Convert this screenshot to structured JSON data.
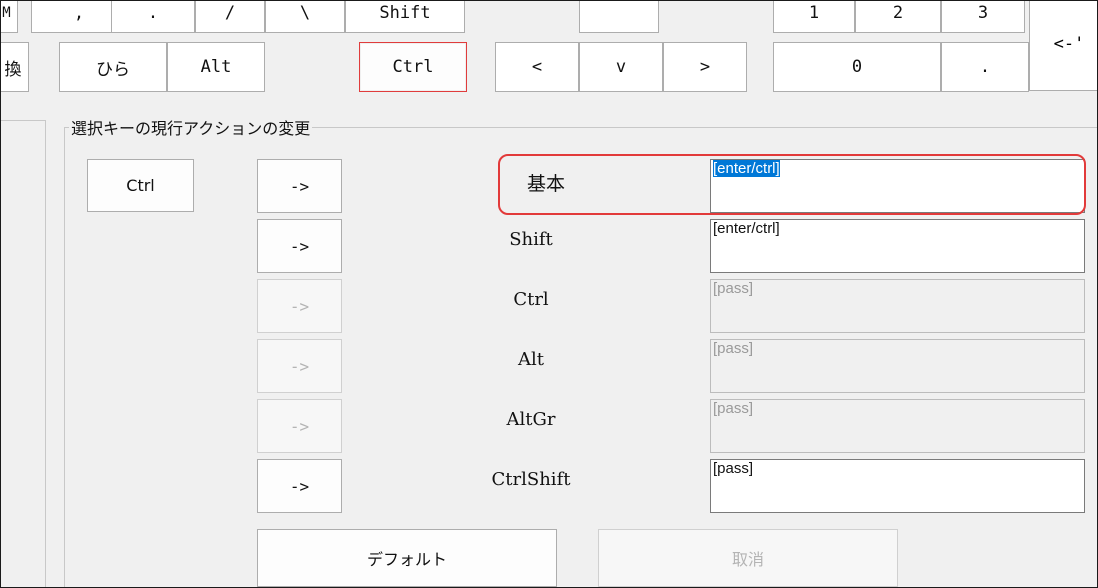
{
  "keyboard": {
    "row1": {
      "m": "M",
      "comma": ",",
      "period": ".",
      "slash": "/",
      "backslash": "\\",
      "shift": "Shift",
      "n1": "1",
      "n2": "2",
      "n3": "3"
    },
    "row2": {
      "henkan_partial": "換",
      "hira": "ひら",
      "alt": "Alt",
      "ctrl": "Ctrl",
      "left": "<",
      "down": "v",
      "right": ">",
      "n0": "0",
      "dot": "."
    },
    "backspace": "<-'"
  },
  "group": {
    "title": "選択キーの現行アクションの変更",
    "selected_key": "Ctrl",
    "arrow": "->",
    "rows": [
      {
        "label": "基本",
        "value": "[enter/ctrl]",
        "enabled": true,
        "selected": true
      },
      {
        "label": "Shift",
        "value": "[enter/ctrl]",
        "enabled": true
      },
      {
        "label": "Ctrl",
        "value": "[pass]",
        "enabled": false
      },
      {
        "label": "Alt",
        "value": "[pass]",
        "enabled": false
      },
      {
        "label": "AltGr",
        "value": "[pass]",
        "enabled": false
      },
      {
        "label": "CtrlShift",
        "value": "[pass]",
        "enabled": true
      }
    ],
    "default_button": "デフォルト",
    "cancel_button": "取消"
  },
  "colors": {
    "highlight": "#e23a3a",
    "selection": "#0078d7"
  }
}
